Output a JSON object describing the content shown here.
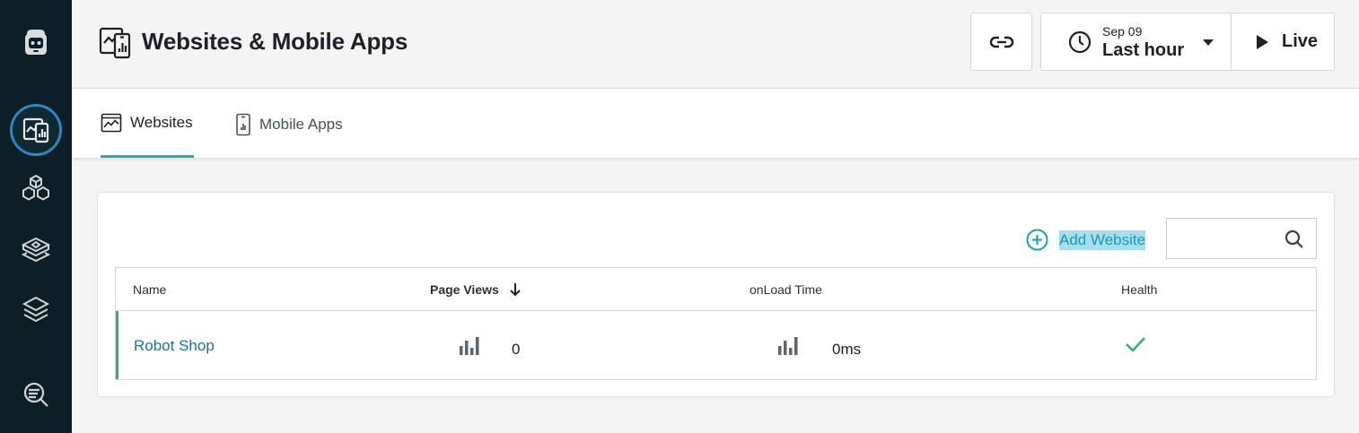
{
  "header": {
    "title": "Websites & Mobile Apps",
    "time_picker": {
      "date": "Sep 09",
      "range": "Last hour"
    },
    "live_label": "Live"
  },
  "tabs": [
    {
      "label": "Websites",
      "active": true
    },
    {
      "label": "Mobile Apps",
      "active": false
    }
  ],
  "toolbar": {
    "add_website_label": "Add Website",
    "search_placeholder": ""
  },
  "table": {
    "columns": [
      "Name",
      "Page Views",
      "onLoad Time",
      "Health"
    ],
    "sort": {
      "column": "Page Views",
      "direction": "descending"
    },
    "rows": [
      {
        "name": "Robot Shop",
        "page_views": "0",
        "onload_time": "0ms",
        "health": "healthy"
      }
    ]
  },
  "colors": {
    "rail_bg": "#0d1f26",
    "accent_teal": "#1fb1a8",
    "link_blue": "#1f6fb0",
    "health_green": "#2fb36b"
  },
  "icons": {
    "rail": [
      "robot-logo-icon",
      "websites-apps-icon",
      "infrastructure-icon",
      "applications-icon",
      "platforms-icon",
      "analytics-icon"
    ]
  }
}
